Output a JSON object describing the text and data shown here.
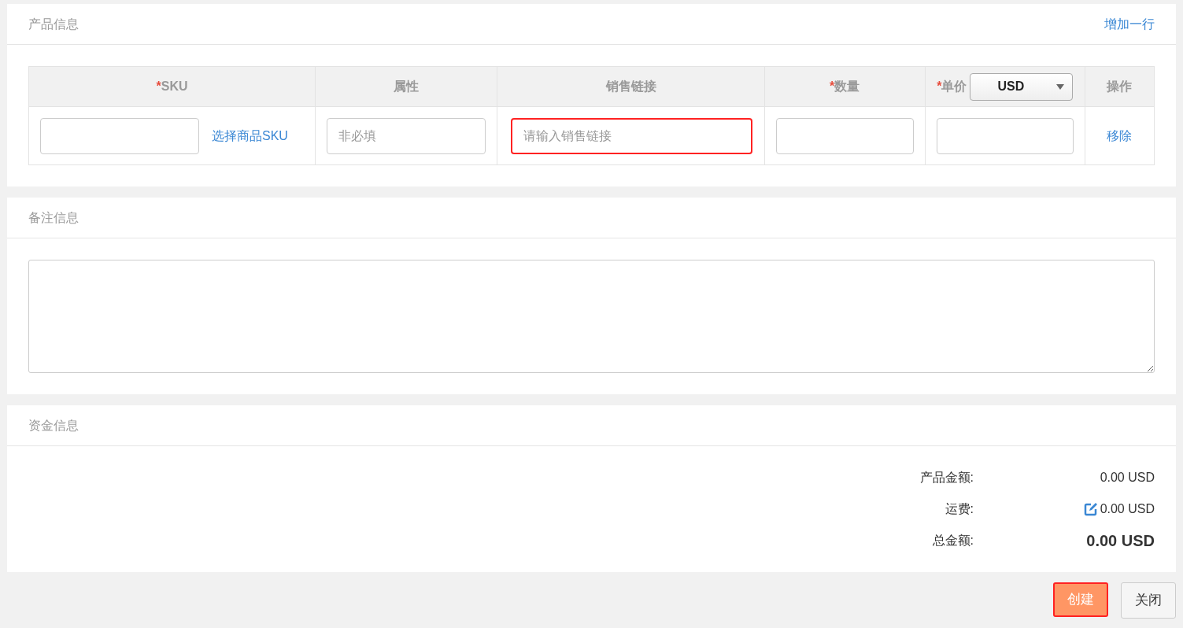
{
  "product_panel": {
    "title": "产品信息",
    "add_row_link": "增加一行",
    "columns": [
      {
        "label": "SKU",
        "required_mark": "*"
      },
      {
        "label": "属性"
      },
      {
        "label": "销售链接"
      },
      {
        "label": "数量",
        "required_mark": "*"
      },
      {
        "label": "单价",
        "required_mark": "*",
        "currency": "USD"
      },
      {
        "label": "操作"
      }
    ],
    "rows": [
      {
        "pick_sku_link": "选择商品SKU",
        "attribute_placeholder": "非必填",
        "link_placeholder": "请输入销售链接",
        "link_invalid": true,
        "remove_link": "移除"
      }
    ]
  },
  "remarks_panel": {
    "title": "备注信息"
  },
  "funds_panel": {
    "title": "资金信息",
    "lines": [
      {
        "kind": "plain",
        "label": "产品金额:",
        "value": "0.00 USD"
      },
      {
        "kind": "editable",
        "label": "运费:",
        "value": "0.00 USD"
      },
      {
        "kind": "total",
        "label": "总金额:",
        "value": "0.00 USD"
      }
    ]
  },
  "buttons": [
    {
      "kind": "primary",
      "label": "创建"
    },
    {
      "kind": "default",
      "label": "关闭"
    }
  ]
}
